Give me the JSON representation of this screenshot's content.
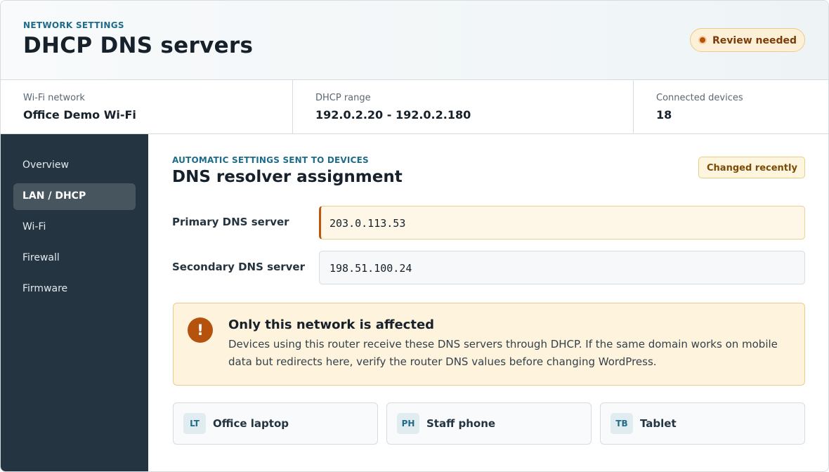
{
  "header": {
    "eyebrow": "NETWORK SETTINGS",
    "title": "DHCP DNS servers",
    "status_badge": "Review needed"
  },
  "stats": [
    {
      "label": "Wi-Fi network",
      "value": "Office Demo Wi-Fi"
    },
    {
      "label": "DHCP range",
      "value": "192.0.2.20 - 192.0.2.180"
    },
    {
      "label": "Connected devices",
      "value": "18"
    }
  ],
  "sidebar": {
    "items": [
      {
        "label": "Overview",
        "active": false
      },
      {
        "label": "LAN / DHCP",
        "active": true
      },
      {
        "label": "Wi-Fi",
        "active": false
      },
      {
        "label": "Firewall",
        "active": false
      },
      {
        "label": "Firmware",
        "active": false
      }
    ]
  },
  "main": {
    "eyebrow": "AUTOMATIC SETTINGS SENT TO DEVICES",
    "title": "DNS resolver assignment",
    "changed_badge": "Changed recently",
    "fields": {
      "primary": {
        "label": "Primary DNS server",
        "value": "203.0.113.53"
      },
      "secondary": {
        "label": "Secondary DNS server",
        "value": "198.51.100.24"
      }
    },
    "alert": {
      "icon": "exclamation-icon",
      "icon_glyph": "!",
      "title": "Only this network is affected",
      "body": "Devices using this router receive these DNS servers through DHCP. If the same domain works on mobile data but redirects here, verify the router DNS values before changing WordPress."
    },
    "devices": [
      {
        "abbr": "LT",
        "name": "Office laptop"
      },
      {
        "abbr": "PH",
        "name": "Staff phone"
      },
      {
        "abbr": "TB",
        "name": "Tablet"
      }
    ]
  },
  "colors": {
    "accent": "#1f6c8a",
    "warning": "#b5520e",
    "sidebar_bg": "#253441"
  }
}
